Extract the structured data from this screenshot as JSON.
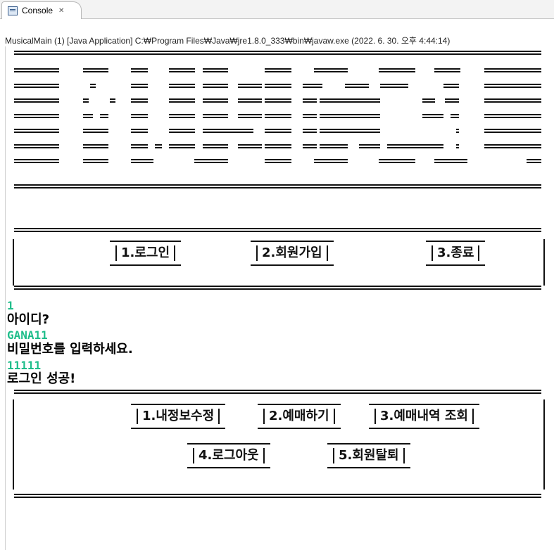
{
  "tab": {
    "label": "Console",
    "close": "✕"
  },
  "description": "MusicalMain (1) [Java Application] C:₩Program Files₩Java₩jre1.8.0_333₩bin₩javaw.exe (2022. 6. 30. 오후 4:44:14)",
  "main_menu": {
    "items": [
      "1.로그인",
      "2.회원가입",
      "3.종료"
    ]
  },
  "io": [
    {
      "type": "input",
      "text": "1"
    },
    {
      "type": "output",
      "text": "아이디?"
    },
    {
      "type": "input",
      "text": "GANA11"
    },
    {
      "type": "output",
      "text": "비밀번호를 입력하세요."
    },
    {
      "type": "input",
      "text": "11111"
    },
    {
      "type": "output",
      "text": "로그인 성공!"
    }
  ],
  "user_menu": {
    "row1": [
      "1.내정보수정",
      "2.예매하기",
      "3.예매내역 조회"
    ],
    "row2": [
      "4.로그아웃",
      "5.회원탈퇴"
    ]
  },
  "colors": {
    "input_text": "#1ebd8a",
    "output_text": "#000000",
    "rule": "#111111"
  }
}
